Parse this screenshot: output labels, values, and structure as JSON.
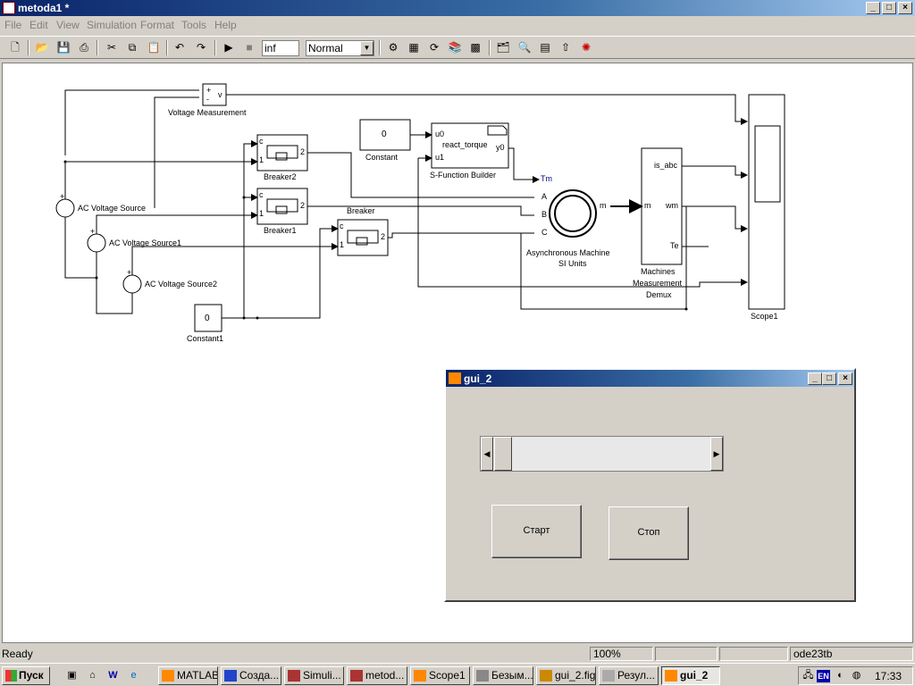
{
  "window": {
    "title": "metoda1 *",
    "caption_buttons": [
      "_",
      "□",
      "×"
    ]
  },
  "menu": [
    "File",
    "Edit",
    "View",
    "Simulation",
    "Format",
    "Tools",
    "Help"
  ],
  "toolbar": {
    "stop_time": "inf",
    "sim_mode": "Normal",
    "icons": [
      "new-icon",
      "open-icon",
      "save-icon",
      "print-icon",
      "cut-icon",
      "copy-icon",
      "paste-icon",
      "undo-icon",
      "redo-icon",
      "play-icon",
      "stop-icon",
      "build-icon",
      "update-diagram-icon",
      "library-browser-icon",
      "model-explorer-icon",
      "debug-icon"
    ]
  },
  "model": {
    "blocks": {
      "voltage_measurement": "Voltage Measurement",
      "vm_plus": "+",
      "vm_minus": "-",
      "vm_out": "v",
      "breaker2": "Breaker2",
      "breaker1": "Breaker1",
      "breaker": "Breaker",
      "breaker_c": "c",
      "breaker_1": "1",
      "breaker_2": "2",
      "constant": "Constant",
      "constant_value": "0",
      "constant1": "Constant1",
      "constant1_value": "0",
      "sfun": "S-Function Builder",
      "sfun_name": "react_torque",
      "sfun_u0": "u0",
      "sfun_u1": "u1",
      "sfun_y0": "y0",
      "src": "AC Voltage Source",
      "src1": "AC Voltage Source1",
      "src2": "AC Voltage Source2",
      "src_plus": "+",
      "machine_line1": "Asynchronous Machine",
      "machine_line2": "SI Units",
      "port_tm": "Tm",
      "port_a": "A",
      "port_b": "B",
      "port_c": "C",
      "port_m": "m",
      "demux_m": "m",
      "demux_is": "is_abc",
      "demux_wm": "wm",
      "demux_te": "Te",
      "demux_line1": "Machines",
      "demux_line2": "Measurement",
      "demux_line3": "Demux",
      "scope": "Scope1"
    }
  },
  "gui": {
    "title": "gui_2",
    "start_label": "Старт",
    "stop_label": "Стоп",
    "slider_value": 0
  },
  "status": {
    "left": "Ready",
    "zoom": "100%",
    "solver": "ode23tb"
  },
  "taskbar": {
    "start": "Пуск",
    "tasks": [
      "MATLAB",
      "Созда...",
      "Simuli...",
      "metod...",
      "Scope1",
      "Безым...",
      "gui_2.fig",
      "Резул...",
      "gui_2"
    ],
    "active_task": "gui_2",
    "lang": "EN",
    "clock": "17:33"
  }
}
